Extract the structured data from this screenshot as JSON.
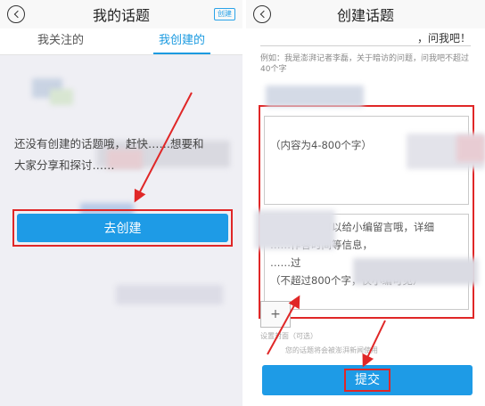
{
  "left": {
    "title": "我的话题",
    "create_tag": "创建",
    "tabs": [
      {
        "label": "我关注的"
      },
      {
        "label": "我创建的"
      }
    ],
    "empty_line1": "还没有创建的话题哦，赶快……想要和",
    "empty_line2": "大家分享和探讨……",
    "create_button": "去创建"
  },
  "right": {
    "title": "创建话题",
    "question_suffix": "，问我吧！",
    "example": "例如：我是澎湃记者李磊，关于暗访的问题，问我吧不超过40个字",
    "content_placeholder": "（内容为4-800个字）",
    "message_line1": "（可选）还可以给小编留言哦，详细",
    "message_line2": "……作答时间等信息，",
    "message_line3": "……过",
    "message_line4": "（不超过800个字，仅小编可见）",
    "add_symbol": "+",
    "cover_caption": "设置封面（可选）",
    "usage_note": "您的话题将会被澎湃新闻使用",
    "submit_button": "提交"
  },
  "colors": {
    "accent": "#1e9be6",
    "highlight": "#e02727",
    "panel_bg": "#efeff4"
  }
}
